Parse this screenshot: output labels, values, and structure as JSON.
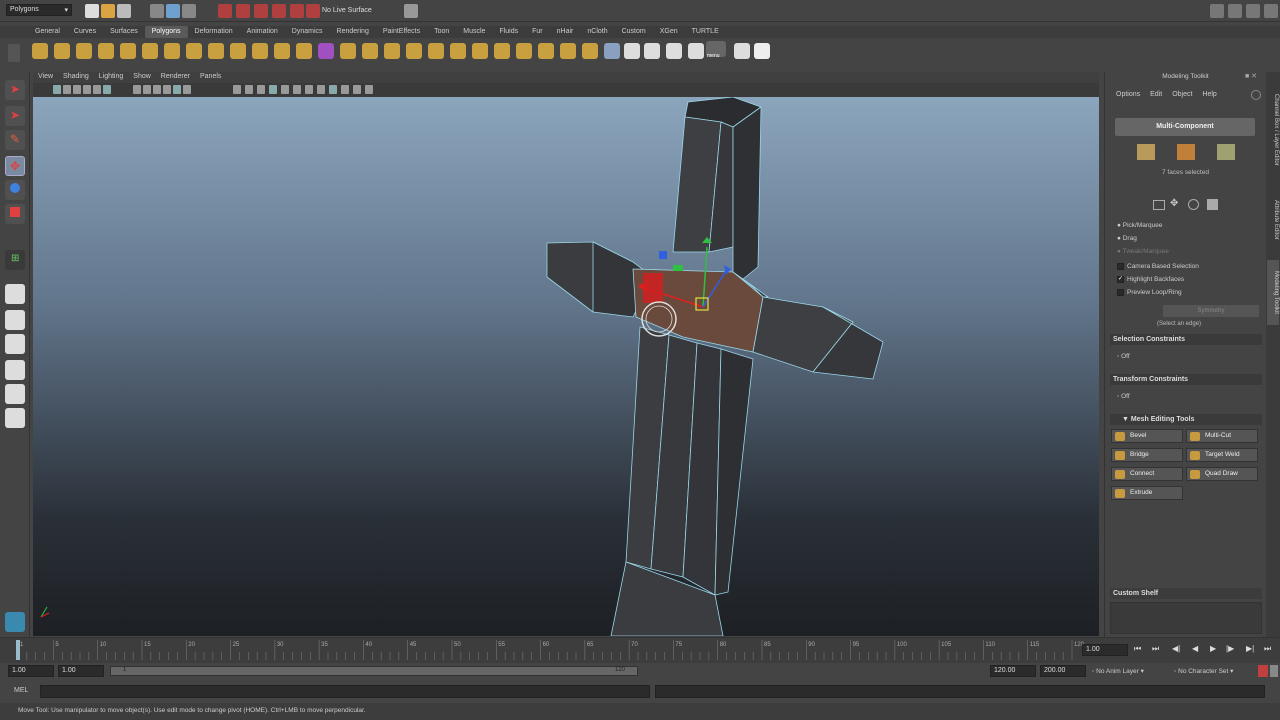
{
  "status_line": {
    "mode_select": "Polygons",
    "live_surface": "No Live Surface"
  },
  "shelf": {
    "tabs": [
      "General",
      "Curves",
      "Surfaces",
      "Polygons",
      "Deformation",
      "Animation",
      "Dynamics",
      "Rendering",
      "PaintEffects",
      "Toon",
      "Muscle",
      "Fluids",
      "Fur",
      "nHair",
      "nCloth",
      "Custom",
      "XGen",
      "TURTLE"
    ],
    "active_tab": "Polygons",
    "icon_label": "menu"
  },
  "viewport": {
    "menus": [
      "View",
      "Shading",
      "Lighting",
      "Show",
      "Renderer",
      "Panels"
    ]
  },
  "toolkit": {
    "title": "Modeling Toolkit",
    "menus": [
      "Options",
      "Edit",
      "Object",
      "Help"
    ],
    "multi_component": "Multi-Component",
    "selection_count": "7 faces selected",
    "radio": [
      "Pick/Marquee",
      "Drag",
      "Tweak/Marquee"
    ],
    "checks": [
      "Camera Based Selection",
      "Highlight Backfaces",
      "Preview Loop/Ring"
    ],
    "symmetry": "Symmetry",
    "symmetry_hint": "(Select an edge)",
    "selection_constraints": "Selection Constraints",
    "selection_constraints_value": "Off",
    "transform_constraints": "Transform Constraints",
    "transform_constraints_value": "Off",
    "mesh_editing": "Mesh Editing Tools",
    "buttons": [
      "Bevel",
      "Multi-Cut",
      "Bridge",
      "Target Weld",
      "Connect",
      "Quad Draw",
      "Extrude"
    ],
    "custom_shelf": "Custom Shelf"
  },
  "side_tabs": [
    "Channel Box / Layer Editor",
    "Attribute Editor",
    "Modeling Toolkit"
  ],
  "timeline": {
    "ticks": [
      "1",
      "5",
      "10",
      "15",
      "20",
      "25",
      "30",
      "35",
      "40",
      "45",
      "50",
      "55",
      "60",
      "65",
      "70",
      "75",
      "80",
      "85",
      "90",
      "95",
      "100",
      "105",
      "110",
      "115",
      "120"
    ],
    "current": "1.00"
  },
  "range": {
    "start": "1.00",
    "inner_start": "1.00",
    "slider_start": "1",
    "slider_end": "120",
    "end": "120.00",
    "outer_end": "200.00",
    "anim_layer": "No Anim Layer",
    "character_set": "No Character Set"
  },
  "command": {
    "label": "MEL"
  },
  "help_line": "Move Tool: Use manipulator to move object(s). Use edit mode to change pivot (HOME). Ctrl+LMB to move perpendicular."
}
